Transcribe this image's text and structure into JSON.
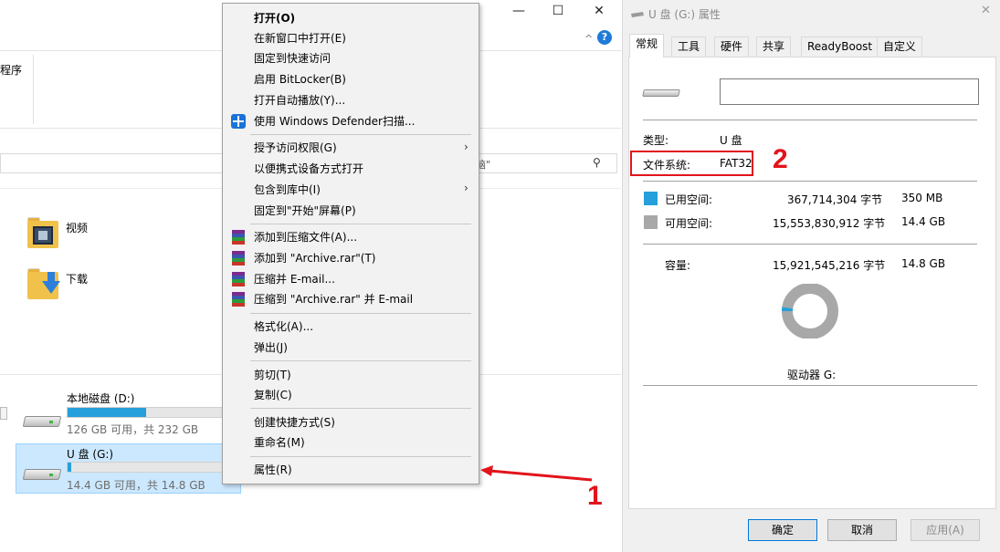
{
  "explorer": {
    "window_controls": {
      "minimize": "—",
      "maximize": "☐",
      "close": "✕"
    },
    "ribbon_partial_label": "程序",
    "search_partial": "脑\"",
    "folders": [
      {
        "label": "视频",
        "icon": "video-folder-icon"
      },
      {
        "label": "下载",
        "icon": "download-folder-icon"
      }
    ],
    "drives": [
      {
        "name": "本地磁盘 (D:)",
        "free_text": "126 GB 可用，共 232 GB",
        "used_fraction": 0.46
      },
      {
        "name": "U 盘 (G:)",
        "free_text": "14.4 GB 可用，共 14.8 GB",
        "used_fraction": 0.02
      }
    ]
  },
  "context_menu": {
    "items": [
      {
        "label": "打开(O)",
        "bold": true
      },
      {
        "label": "在新窗口中打开(E)"
      },
      {
        "label": "固定到快速访问"
      },
      {
        "label": "启用 BitLocker(B)"
      },
      {
        "label": "打开自动播放(Y)..."
      },
      {
        "label": "使用 Windows Defender扫描...",
        "icon": "windows-defender-icon"
      },
      {
        "label": "授予访问权限(G)",
        "submenu": true
      },
      {
        "label": "以便携式设备方式打开"
      },
      {
        "label": "包含到库中(I)",
        "submenu": true
      },
      {
        "label": "固定到\"开始\"屏幕(P)"
      },
      {
        "label": "添加到压缩文件(A)...",
        "icon": "winrar-icon"
      },
      {
        "label": "添加到 \"Archive.rar\"(T)",
        "icon": "winrar-icon"
      },
      {
        "label": "压缩并 E-mail...",
        "icon": "winrar-icon"
      },
      {
        "label": "压缩到 \"Archive.rar\" 并 E-mail",
        "icon": "winrar-icon"
      },
      {
        "label": "格式化(A)..."
      },
      {
        "label": "弹出(J)"
      },
      {
        "label": "剪切(T)"
      },
      {
        "label": "复制(C)"
      },
      {
        "label": "创建快捷方式(S)"
      },
      {
        "label": "重命名(M)"
      },
      {
        "label": "属性(R)"
      }
    ]
  },
  "annotations": {
    "step1": "1",
    "step2": "2",
    "color": "#e2141b"
  },
  "properties": {
    "title": "U 盘 (G:) 属性",
    "close": "✕",
    "tabs": [
      "常规",
      "工具",
      "硬件",
      "共享",
      "ReadyBoost",
      "自定义"
    ],
    "active_tab": "常规",
    "volume_name_value": "",
    "type_label": "类型:",
    "type_value": "U 盘",
    "fs_label": "文件系统:",
    "fs_value": "FAT32",
    "used_label": "已用空间:",
    "used_bytes": "367,714,304 字节",
    "used_size": "350 MB",
    "used_color": "#26a0da",
    "free_label": "可用空间:",
    "free_bytes": "15,553,830,912 字节",
    "free_size": "14.4 GB",
    "free_color": "#a8a8a8",
    "capacity_label": "容量:",
    "capacity_bytes": "15,921,545,216 字节",
    "capacity_size": "14.8 GB",
    "used_fraction": 0.023,
    "drive_label": "驱动器 G:",
    "buttons": {
      "ok": "确定",
      "cancel": "取消",
      "apply": "应用(A)"
    }
  }
}
